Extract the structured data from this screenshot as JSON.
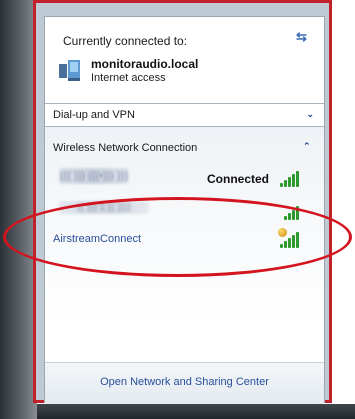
{
  "header": {
    "connected_to_label": "Currently connected to:",
    "refresh_icon": "refresh-arrows-icon"
  },
  "current_network": {
    "name": "monitoraudio.local",
    "status": "Internet access",
    "icon": "network-computer-icon"
  },
  "dialup": {
    "label": "Dial-up and VPN",
    "icon": "chevron-down-icon"
  },
  "wireless": {
    "label": "Wireless Network Connection",
    "icon": "chevron-up-icon",
    "networks": [
      {
        "name": "((( ))) (((•))) )))",
        "status": "Connected",
        "signal_bars": 5,
        "secured": false
      },
      {
        "name": "(( ))) 1 (( ))))",
        "status": "",
        "signal_bars": 5,
        "secured": false
      },
      {
        "name": "AirstreamConnect",
        "status": "",
        "signal_bars": 5,
        "secured": true
      }
    ]
  },
  "footer": {
    "link": "Open Network and Sharing Center"
  },
  "colors": {
    "highlight_ellipse": "#d3141e",
    "frame": "#c2202a",
    "link": "#2a4f9a",
    "signal": "#2e9a2e"
  }
}
